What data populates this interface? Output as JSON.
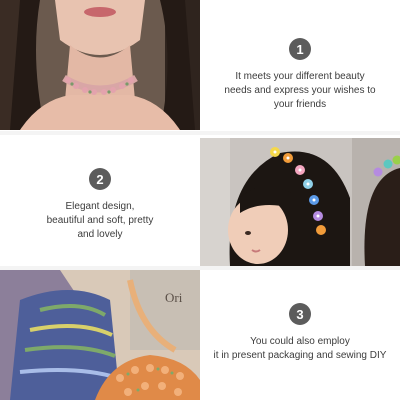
{
  "features": [
    {
      "number": "1",
      "text": "It meets your different beauty\nneeds and express your wishes to\nyour friends"
    },
    {
      "number": "2",
      "text": "Elegant design,\nbeautiful and soft, pretty\nand lovely"
    },
    {
      "number": "3",
      "text": "You could also employ\nit in present packaging and sewing DIY"
    }
  ],
  "photos": [
    {
      "subject": "woman-wearing-flower-choker"
    },
    {
      "subject": "girl-with-flower-headband"
    },
    {
      "subject": "flower-lace-sewn-on-bags",
      "newsprint_text": "Ori"
    }
  ],
  "colors": {
    "badge": "#5c5c5c",
    "text": "#3c3c3c",
    "background": "#ffffff"
  }
}
